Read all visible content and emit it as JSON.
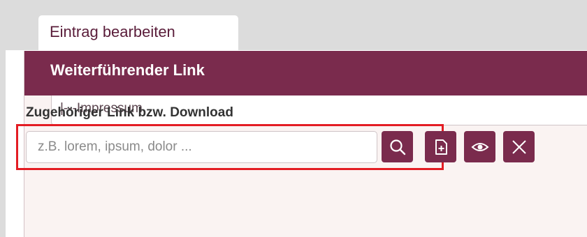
{
  "tab": {
    "label": "Eintrag bearbeiten"
  },
  "panel": {
    "title": "Weiterführender Link",
    "select_value": "|---Impressum"
  },
  "download_field": {
    "label": "Zugehöriger Link bzw. Download",
    "placeholder": "z.B. lorem, ipsum, dolor ...",
    "value": ""
  },
  "buttons": [
    {
      "name": "search",
      "icon": "search-icon"
    },
    {
      "name": "add-file",
      "icon": "file-plus-icon"
    },
    {
      "name": "preview",
      "icon": "eye-icon"
    },
    {
      "name": "clear",
      "icon": "close-icon"
    }
  ],
  "colors": {
    "brand": "#7a2b4d",
    "highlight": "#e31c23",
    "panel_bg": "#faf3f2",
    "page_bg": "#dcdcdc"
  }
}
